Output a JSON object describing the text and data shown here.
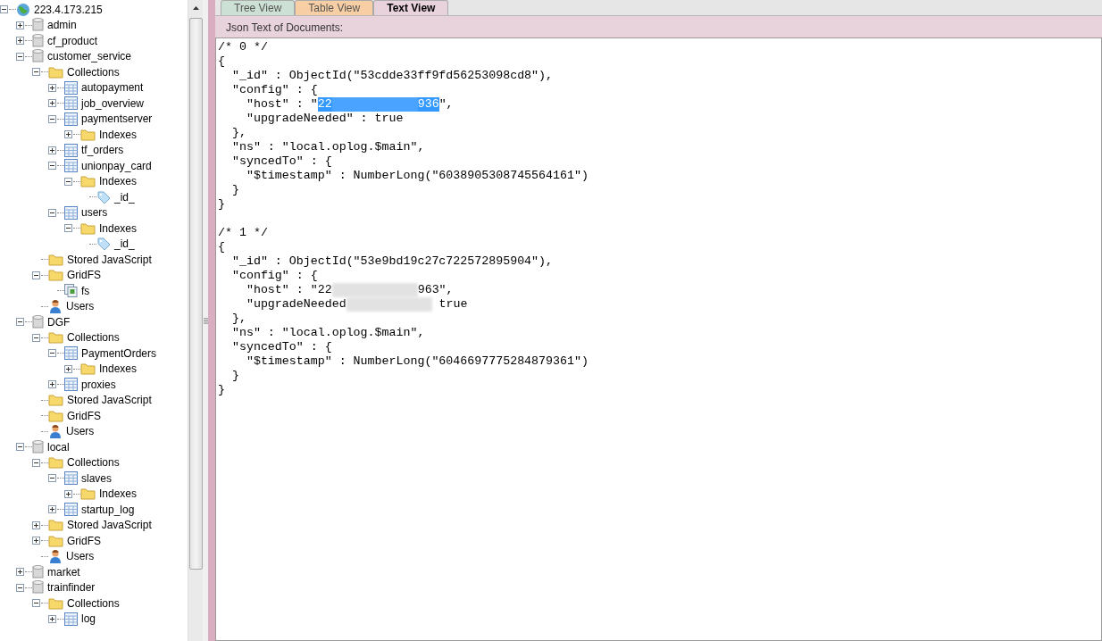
{
  "tree": [
    {
      "label": "223.4.173.215",
      "kind": "server",
      "expanded": true,
      "children": [
        {
          "label": "admin",
          "kind": "database",
          "expanded": false
        },
        {
          "label": "cf_product",
          "kind": "database",
          "expanded": false
        },
        {
          "label": "customer_service",
          "kind": "database",
          "expanded": true,
          "children": [
            {
              "label": "Collections",
              "kind": "folder",
              "expanded": true,
              "children": [
                {
                  "label": "autopayment",
                  "kind": "collection",
                  "expanded": false
                },
                {
                  "label": "job_overview",
                  "kind": "collection",
                  "expanded": false
                },
                {
                  "label": "paymentserver",
                  "kind": "collection",
                  "expanded": true,
                  "children": [
                    {
                      "label": "Indexes",
                      "kind": "folder",
                      "expanded": false
                    }
                  ]
                },
                {
                  "label": "tf_orders",
                  "kind": "collection",
                  "expanded": false
                },
                {
                  "label": "unionpay_card",
                  "kind": "collection",
                  "expanded": true,
                  "children": [
                    {
                      "label": "Indexes",
                      "kind": "folder",
                      "expanded": true,
                      "children": [
                        {
                          "label": "_id_",
                          "kind": "index"
                        }
                      ]
                    }
                  ]
                },
                {
                  "label": "users",
                  "kind": "collection",
                  "expanded": true,
                  "children": [
                    {
                      "label": "Indexes",
                      "kind": "folder",
                      "expanded": true,
                      "children": [
                        {
                          "label": "_id_",
                          "kind": "index"
                        }
                      ]
                    }
                  ]
                }
              ]
            },
            {
              "label": "Stored JavaScript",
              "kind": "folder"
            },
            {
              "label": "GridFS",
              "kind": "folder",
              "expanded": true,
              "children": [
                {
                  "label": "fs",
                  "kind": "gridfs"
                }
              ]
            },
            {
              "label": "Users",
              "kind": "user"
            }
          ]
        },
        {
          "label": "DGF",
          "kind": "database",
          "expanded": true,
          "children": [
            {
              "label": "Collections",
              "kind": "folder",
              "expanded": true,
              "children": [
                {
                  "label": "PaymentOrders",
                  "kind": "collection",
                  "expanded": true,
                  "children": [
                    {
                      "label": "Indexes",
                      "kind": "folder",
                      "expanded": false
                    }
                  ]
                },
                {
                  "label": "proxies",
                  "kind": "collection",
                  "expanded": false
                }
              ]
            },
            {
              "label": "Stored JavaScript",
              "kind": "folder"
            },
            {
              "label": "GridFS",
              "kind": "folder"
            },
            {
              "label": "Users",
              "kind": "user"
            }
          ]
        },
        {
          "label": "local",
          "kind": "database",
          "expanded": true,
          "children": [
            {
              "label": "Collections",
              "kind": "folder",
              "expanded": true,
              "children": [
                {
                  "label": "slaves",
                  "kind": "collection",
                  "expanded": true,
                  "children": [
                    {
                      "label": "Indexes",
                      "kind": "folder",
                      "expanded": false
                    }
                  ]
                },
                {
                  "label": "startup_log",
                  "kind": "collection",
                  "expanded": false
                }
              ]
            },
            {
              "label": "Stored JavaScript",
              "kind": "folder",
              "expanded": false
            },
            {
              "label": "GridFS",
              "kind": "folder",
              "expanded": false
            },
            {
              "label": "Users",
              "kind": "user"
            }
          ]
        },
        {
          "label": "market",
          "kind": "database",
          "expanded": false
        },
        {
          "label": "trainfinder",
          "kind": "database",
          "expanded": true,
          "children": [
            {
              "label": "Collections",
              "kind": "folder",
              "expanded": true,
              "children": [
                {
                  "label": "log",
                  "kind": "collection",
                  "expanded": false
                }
              ]
            }
          ]
        }
      ]
    }
  ],
  "tabs": [
    {
      "label": "Tree View",
      "selected": false
    },
    {
      "label": "Table View",
      "selected": false
    },
    {
      "label": "Text View",
      "selected": true
    }
  ],
  "editor": {
    "caption": "Json Text of Documents:",
    "lines": [
      [
        {
          "kind": "text",
          "text": "/* 0 */"
        }
      ],
      [
        {
          "kind": "text",
          "text": "{"
        }
      ],
      [
        {
          "kind": "text",
          "text": "  \"_id\" : ObjectId(\"53cdde33ff9fd56253098cd8\"),"
        }
      ],
      [
        {
          "kind": "text",
          "text": "  \"config\" : {"
        }
      ],
      [
        {
          "kind": "text",
          "text": "    \"host\" : \""
        },
        {
          "kind": "text",
          "text": "22",
          "selected": true
        },
        {
          "kind": "redacted",
          "selected": true
        },
        {
          "kind": "text",
          "text": "936",
          "selected": true
        },
        {
          "kind": "text",
          "text": "\","
        }
      ],
      [
        {
          "kind": "text",
          "text": "    \"upgradeNeeded\" : true"
        }
      ],
      [
        {
          "kind": "text",
          "text": "  },"
        }
      ],
      [
        {
          "kind": "text",
          "text": "  \"ns\" : \"local.oplog.$main\","
        }
      ],
      [
        {
          "kind": "text",
          "text": "  \"syncedTo\" : {"
        }
      ],
      [
        {
          "kind": "text",
          "text": "    \"$timestamp\" : NumberLong(\"6038905308745564161\")"
        }
      ],
      [
        {
          "kind": "text",
          "text": "  }"
        }
      ],
      [
        {
          "kind": "text",
          "text": "}"
        }
      ],
      {
        "kind": "blank"
      },
      [
        {
          "kind": "text",
          "text": "/* 1 */"
        }
      ],
      [
        {
          "kind": "text",
          "text": "{"
        }
      ],
      [
        {
          "kind": "text",
          "text": "  \"_id\" : ObjectId(\"53e9bd19c27c722572895904\"),"
        }
      ],
      [
        {
          "kind": "text",
          "text": "  \"config\" : {"
        }
      ],
      [
        {
          "kind": "text",
          "text": "    \"host\" : \"22"
        },
        {
          "kind": "redacted",
          "selected": false
        },
        {
          "kind": "text",
          "text": "963\","
        }
      ],
      [
        {
          "kind": "text",
          "text": "    \"upgradeNeeded"
        },
        {
          "kind": "redacted",
          "selected": false
        },
        {
          "kind": "text",
          "text": " true"
        }
      ],
      [
        {
          "kind": "text",
          "text": "  },"
        }
      ],
      [
        {
          "kind": "text",
          "text": "  \"ns\" : \"local.oplog.$main\","
        }
      ],
      [
        {
          "kind": "text",
          "text": "  \"syncedTo\" : {"
        }
      ],
      [
        {
          "kind": "text",
          "text": "    \"$timestamp\" : NumberLong(\"6046697775284879361\")"
        }
      ],
      [
        {
          "kind": "text",
          "text": "  }"
        }
      ],
      [
        {
          "kind": "text",
          "text": "}"
        }
      ]
    ]
  }
}
